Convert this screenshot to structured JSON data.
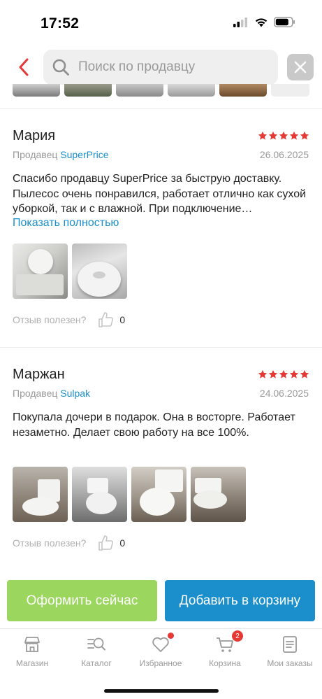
{
  "status_bar": {
    "time": "17:52"
  },
  "search": {
    "placeholder": "Поиск по продавцу",
    "value": ""
  },
  "reviews": [
    {
      "name": "Мария",
      "rating": 5,
      "seller_prefix": "Продавец",
      "seller": "SuperPrice",
      "date": "26.06.2025",
      "text": "Спасибо продавцу SuperPrice за быструю доставку. Пылесос очень понравился, работает отлично как сухой уборкой, так и с влажной. При подключение…",
      "show_more": "Показать полностью",
      "helpful_label": "Отзыв полезен?",
      "likes": "0"
    },
    {
      "name": "Маржан",
      "rating": 5,
      "seller_prefix": "Продавец",
      "seller": "Sulpak",
      "date": "24.06.2025",
      "text": "Покупала дочери в подарок. Она в восторге. Работает незаметно. Делает свою работу на все 100%.",
      "helpful_label": "Отзыв полезен?",
      "likes": "0"
    }
  ],
  "actions": {
    "checkout": "Оформить сейчас",
    "add_to_cart": "Добавить в корзину"
  },
  "tabs": [
    {
      "label": "Магазин",
      "icon": "shop-icon"
    },
    {
      "label": "Каталог",
      "icon": "catalog-icon"
    },
    {
      "label": "Избранное",
      "icon": "heart-icon"
    },
    {
      "label": "Корзина",
      "icon": "cart-icon",
      "badge": "2"
    },
    {
      "label": "Мои заказы",
      "icon": "orders-icon"
    }
  ],
  "colors": {
    "accent": "#1a8fcb",
    "checkout": "#9bd65e",
    "star": "#e53935",
    "badge": "#e53935"
  }
}
